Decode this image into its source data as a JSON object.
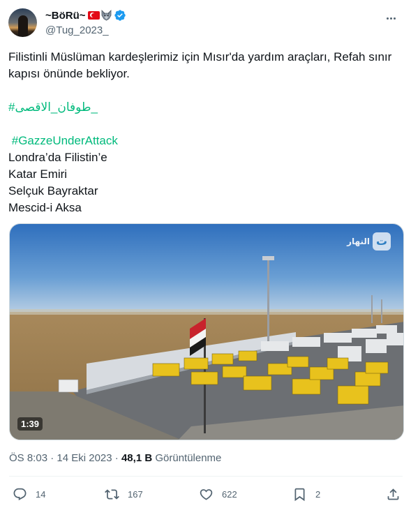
{
  "author": {
    "display_name": "~BöRü~",
    "handle": "@Tug_2023_",
    "avatar_icon": "avatar-silhouette-sunset",
    "badges": [
      "turkey-flag-icon",
      "wolf-icon",
      "verified-badge-icon"
    ],
    "verified_color": "#1d9bf0"
  },
  "tweet": {
    "lines": [
      "Filistinli Müslüman kardeşlerimiz için Mısır'da yardım araçları, Refah sınır",
      "kapısı önünde bekliyor."
    ],
    "hashtag_arabic": "#طوفان_الاقصى_",
    "hashtag_gaza": "#GazzeUnderAttack",
    "list_lines": [
      "Londra’da Filistin’e",
      "Katar Emiri",
      "Selçuk Bayraktar",
      "Mescid-i Aksa"
    ]
  },
  "media": {
    "duration": "1:39",
    "channel_text": "النهار",
    "channel_icon": "channel-logo-icon"
  },
  "meta": {
    "time": "ÖS 8:03",
    "separator": "·",
    "date": "14 Eki 2023",
    "views_count": "48,1 B",
    "views_label": "Görüntülenme"
  },
  "actions": {
    "reply_count": "14",
    "retweet_count": "167",
    "like_count": "622",
    "bookmark_count": "2"
  },
  "colors": {
    "accent": "#1d9bf0",
    "hashtag_green": "#00ba7c",
    "secondary_text": "#536471"
  }
}
